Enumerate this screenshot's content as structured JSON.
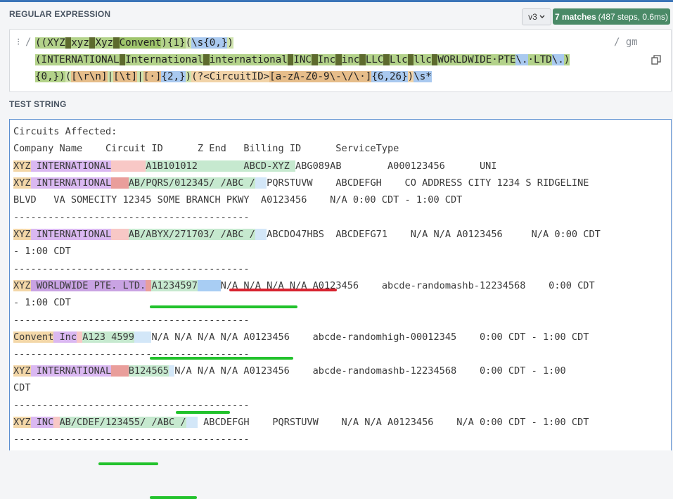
{
  "regex_section": {
    "label": "REGULAR EXPRESSION",
    "flavor": "v3",
    "matches": "7 matches",
    "steps": "(487 steps, 0.6ms)",
    "handle": "⁝",
    "delimiter_open": "/",
    "flags": "/ gm",
    "lines": [
      "((XYZ|xyz|Xyz|Convent){1}(\\s{0,})",
      "(INTERNATIONAL|International|international|INC|Inc|inc|LLC|Llc|llc|WORLDWIDE PTE\\. LTD\\.)",
      "{0,})([\\r\\n]|[\\t]|[ ]{2,})(?<CircuitID>[a-zA-Z0-9\\-\\/\\ ]{6,26})\\s*"
    ]
  },
  "test_section": {
    "label": "TEST STRING",
    "lines": [
      "Circuits Affected:",
      "Company Name    Circuit ID      Z End   Billing ID      ServiceType",
      "XYZ INTERNATIONAL      A1B101012        ABCD-XYZ ABG089AB        A000123456      UNI",
      "XYZ INTERNATIONAL   AB/PQRS/012345/ /ABC /  PQRSTUVW    ABCDEFGH    CO ADDRESS CITY 1234 S RIDGELINE",
      "BLVD   VA SOMECITY 12345 SOME BRANCH PKWY  A0123456    N/A 0:00 CDT - 1:00 CDT",
      "-----------------------------------------",
      "XYZ INTERNATIONAL   AB/ABYX/271703/ /ABC /  ABCDO47HBS  ABCDEFG71    N/A N/A A0123456     N/A 0:00 CDT",
      "- 1:00 CDT",
      "-----------------------------------------",
      "XYZ WORLDWIDE PTE. LTD. A1234597    N/A N/A N/A N/A A0123456    abcde-randomashb-12234568    0:00 CDT",
      "- 1:00 CDT",
      "-----------------------------------------",
      "Convent Inc A123 4599   N/A N/A N/A N/A A0123456    abcde-randomhigh-00012345    0:00 CDT - 1:00 CDT",
      "-----------------------------------------",
      "XYZ INTERNATIONAL   B124565 N/A N/A N/A A0123456    abcde-randomashb-12234568    0:00 CDT - 1:00",
      "CDT",
      "-----------------------------------------",
      "XYZ INC AB/CDEF/123455/ /ABC /   ABCDEFGH    PQRSTUVW    N/A N/A A0123456    N/A 0:00 CDT - 1:00 CDT",
      "-----------------------------------------"
    ]
  },
  "colors": {
    "match_badge": "#4a8a67",
    "underline_red": "#d7232f",
    "underline_green": "#22c22c",
    "test_border": "#5c8fd0"
  },
  "icons": {
    "copy": "copy-icon",
    "chevron": "chevron-down-icon"
  }
}
